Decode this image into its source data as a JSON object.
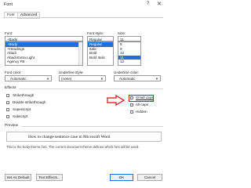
{
  "window": {
    "title": "Font",
    "help_glyph": "?",
    "close_glyph": "✕"
  },
  "tabs": [
    {
      "label": "Font",
      "active": true
    },
    {
      "label": "Advanced",
      "active": false
    }
  ],
  "font": {
    "label": "Font:",
    "value": "+Body",
    "options": [
      "+Body",
      "+Headings",
      "Abadi",
      "Abadi Extra Light",
      "Agency FB"
    ],
    "selected_index": 0
  },
  "font_style": {
    "label": "Font style:",
    "value": "Regular",
    "options": [
      "Regular",
      "Italic",
      "Bold",
      "Bold Italic"
    ],
    "selected_index": 0
  },
  "size": {
    "label": "Size:",
    "value": "11",
    "options": [
      "8",
      "9",
      "10",
      "11",
      "12"
    ],
    "selected_index": 3
  },
  "font_color": {
    "label": "Font color:",
    "value": "Automatic"
  },
  "underline_style": {
    "label": "Underline style:",
    "value": "(none)"
  },
  "underline_color": {
    "label": "Underline color:",
    "value": "Automatic"
  },
  "effects": {
    "label": "Effects",
    "left": [
      "Strikethrough",
      "Double strikethrough",
      "Superscript",
      "Subscript"
    ],
    "right": [
      "Small caps",
      "All caps",
      "Hidden"
    ],
    "highlight_color": "#d11111"
  },
  "preview": {
    "label": "Preview",
    "text": "How to change sentence case in Microsoft Word",
    "note": "This is the body theme font. The current document theme defines which font will be used."
  },
  "buttons": {
    "set_default": "Set As Default",
    "text_effects": "Text Effects...",
    "ok": "OK",
    "cancel": "Cancel"
  },
  "colors": {
    "accent": "#1f6fd6",
    "highlight": "#d11111"
  }
}
